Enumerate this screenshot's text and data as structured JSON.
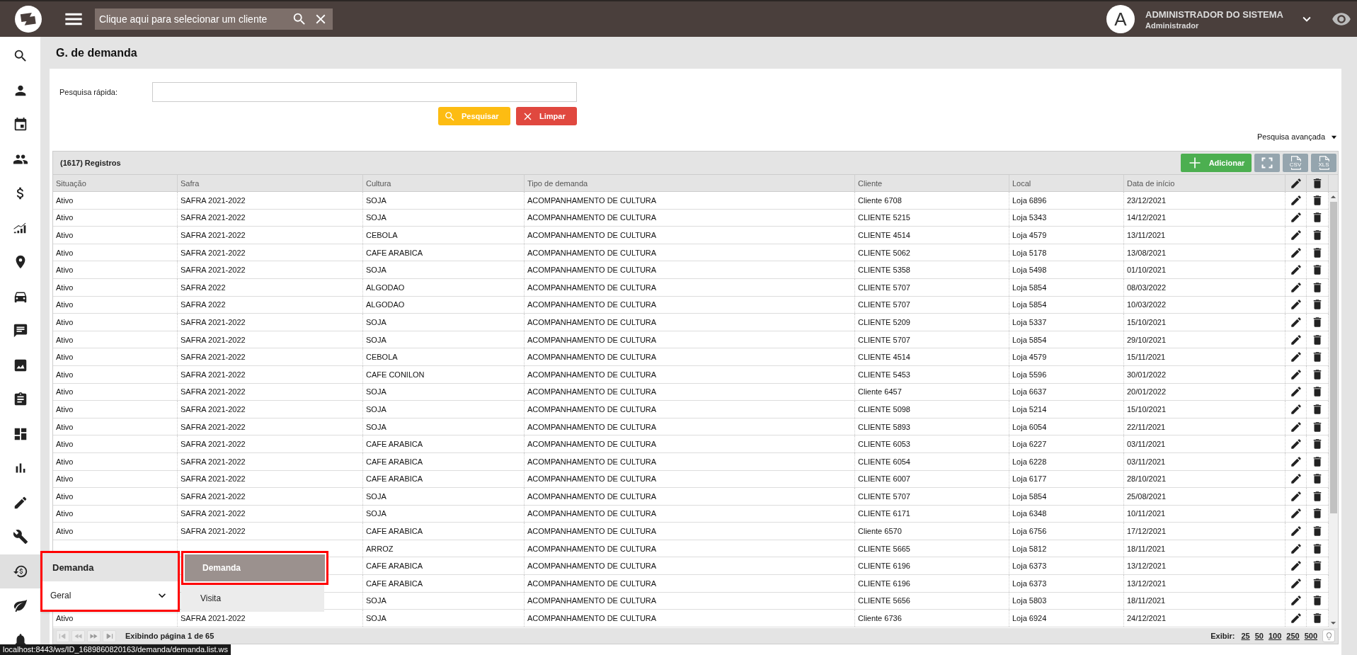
{
  "app_bar": {
    "client_search": {
      "placeholder": "Clique aqui para selecionar um cliente"
    },
    "user": {
      "avatar_letter": "A",
      "name": "ADMINISTRADOR DO SISTEMA",
      "role": "Administrador"
    }
  },
  "sidebar": {
    "items": [
      {
        "kind": "search",
        "selected": false
      },
      {
        "kind": "person",
        "selected": false
      },
      {
        "kind": "calendar",
        "selected": false
      },
      {
        "kind": "people",
        "selected": false
      },
      {
        "kind": "dollar",
        "selected": false
      },
      {
        "kind": "signal",
        "selected": false
      },
      {
        "kind": "pin",
        "selected": false
      },
      {
        "kind": "car",
        "selected": false
      },
      {
        "kind": "chat",
        "selected": false
      },
      {
        "kind": "image",
        "selected": false
      },
      {
        "kind": "clipboard",
        "selected": false
      },
      {
        "kind": "dashboard",
        "selected": false
      },
      {
        "kind": "bars",
        "selected": false
      },
      {
        "kind": "pencil",
        "selected": false
      },
      {
        "kind": "wrench",
        "selected": false
      },
      {
        "kind": "history",
        "selected": true
      },
      {
        "kind": "leaf",
        "selected": false
      },
      {
        "kind": "bell",
        "selected": false
      }
    ]
  },
  "page_title": "G. de demanda",
  "quick_search": {
    "label": "Pesquisa rápida:",
    "buttons": [
      {
        "kind": "search",
        "label": "Pesquisar"
      },
      {
        "kind": "clear",
        "label": "Limpar"
      }
    ]
  },
  "advanced_search": {
    "label": "Pesquisa avançada",
    "expanded": false
  },
  "grid": {
    "count": "(1617) Registros",
    "toolbar": [
      {
        "kind": "add",
        "label": "Adicionar"
      },
      {
        "kind": "fullscreen"
      },
      {
        "kind": "file",
        "label": "CSV"
      },
      {
        "kind": "file",
        "label": "XLS"
      }
    ],
    "columns": [
      "Situação",
      "Safra",
      "Cultura",
      "Tipo de demanda",
      "Cliente",
      "Local",
      "Data de início"
    ],
    "rows": [
      {
        "situacao": "Ativo",
        "safra": "SAFRA 2021-2022",
        "cultura": "SOJA",
        "tipo": "ACOMPANHAMENTO DE CULTURA",
        "cliente": "Cliente 6708",
        "local": "Loja 6896",
        "data": "23/12/2021"
      },
      {
        "situacao": "Ativo",
        "safra": "SAFRA 2021-2022",
        "cultura": "SOJA",
        "tipo": "ACOMPANHAMENTO DE CULTURA",
        "cliente": "CLIENTE 5215",
        "local": "Loja 5343",
        "data": "14/12/2021"
      },
      {
        "situacao": "Ativo",
        "safra": "SAFRA 2021-2022",
        "cultura": "CEBOLA",
        "tipo": "ACOMPANHAMENTO DE CULTURA",
        "cliente": "CLIENTE 4514",
        "local": "Loja 4579",
        "data": "13/11/2021"
      },
      {
        "situacao": "Ativo",
        "safra": "SAFRA 2021-2022",
        "cultura": "CAFE ARABICA",
        "tipo": "ACOMPANHAMENTO DE CULTURA",
        "cliente": "CLIENTE 5062",
        "local": "Loja 5178",
        "data": "13/08/2021"
      },
      {
        "situacao": "Ativo",
        "safra": "SAFRA 2021-2022",
        "cultura": "SOJA",
        "tipo": "ACOMPANHAMENTO DE CULTURA",
        "cliente": "CLIENTE 5358",
        "local": "Loja 5498",
        "data": "01/10/2021"
      },
      {
        "situacao": "Ativo",
        "safra": "SAFRA 2022",
        "cultura": "ALGODAO",
        "tipo": "ACOMPANHAMENTO DE CULTURA",
        "cliente": "CLIENTE 5707",
        "local": "Loja 5854",
        "data": "08/03/2022"
      },
      {
        "situacao": "Ativo",
        "safra": "SAFRA 2022",
        "cultura": "ALGODAO",
        "tipo": "ACOMPANHAMENTO DE CULTURA",
        "cliente": "CLIENTE 5707",
        "local": "Loja 5854",
        "data": "10/03/2022"
      },
      {
        "situacao": "Ativo",
        "safra": "SAFRA 2021-2022",
        "cultura": "SOJA",
        "tipo": "ACOMPANHAMENTO DE CULTURA",
        "cliente": "CLIENTE 5209",
        "local": "Loja 5337",
        "data": "15/10/2021"
      },
      {
        "situacao": "Ativo",
        "safra": "SAFRA 2021-2022",
        "cultura": "SOJA",
        "tipo": "ACOMPANHAMENTO DE CULTURA",
        "cliente": "CLIENTE 5707",
        "local": "Loja 5854",
        "data": "29/10/2021"
      },
      {
        "situacao": "Ativo",
        "safra": "SAFRA 2021-2022",
        "cultura": "CEBOLA",
        "tipo": "ACOMPANHAMENTO DE CULTURA",
        "cliente": "CLIENTE 4514",
        "local": "Loja 4579",
        "data": "15/11/2021"
      },
      {
        "situacao": "Ativo",
        "safra": "SAFRA 2021-2022",
        "cultura": "CAFE CONILON",
        "tipo": "ACOMPANHAMENTO DE CULTURA",
        "cliente": "CLIENTE 5453",
        "local": "Loja 5596",
        "data": "30/01/2022"
      },
      {
        "situacao": "Ativo",
        "safra": "SAFRA 2021-2022",
        "cultura": "SOJA",
        "tipo": "ACOMPANHAMENTO DE CULTURA",
        "cliente": "Cliente 6457",
        "local": "Loja 6637",
        "data": "20/01/2022"
      },
      {
        "situacao": "Ativo",
        "safra": "SAFRA 2021-2022",
        "cultura": "SOJA",
        "tipo": "ACOMPANHAMENTO DE CULTURA",
        "cliente": "CLIENTE 5098",
        "local": "Loja 5214",
        "data": "15/10/2021"
      },
      {
        "situacao": "Ativo",
        "safra": "SAFRA 2021-2022",
        "cultura": "SOJA",
        "tipo": "ACOMPANHAMENTO DE CULTURA",
        "cliente": "CLIENTE 5893",
        "local": "Loja 6054",
        "data": "22/11/2021"
      },
      {
        "situacao": "Ativo",
        "safra": "SAFRA 2021-2022",
        "cultura": "CAFE ARABICA",
        "tipo": "ACOMPANHAMENTO DE CULTURA",
        "cliente": "CLIENTE 6053",
        "local": "Loja 6227",
        "data": "03/11/2021"
      },
      {
        "situacao": "Ativo",
        "safra": "SAFRA 2021-2022",
        "cultura": "CAFE ARABICA",
        "tipo": "ACOMPANHAMENTO DE CULTURA",
        "cliente": "CLIENTE 6054",
        "local": "Loja 6228",
        "data": "03/11/2021"
      },
      {
        "situacao": "Ativo",
        "safra": "SAFRA 2021-2022",
        "cultura": "CAFE ARABICA",
        "tipo": "ACOMPANHAMENTO DE CULTURA",
        "cliente": "CLIENTE 6007",
        "local": "Loja 6177",
        "data": "28/10/2021"
      },
      {
        "situacao": "Ativo",
        "safra": "SAFRA 2021-2022",
        "cultura": "SOJA",
        "tipo": "ACOMPANHAMENTO DE CULTURA",
        "cliente": "CLIENTE 5707",
        "local": "Loja 5854",
        "data": "25/08/2021"
      },
      {
        "situacao": "Ativo",
        "safra": "SAFRA 2021-2022",
        "cultura": "SOJA",
        "tipo": "ACOMPANHAMENTO DE CULTURA",
        "cliente": "CLIENTE 6171",
        "local": "Loja 6348",
        "data": "10/11/2021"
      },
      {
        "situacao": "Ativo",
        "safra": "SAFRA 2021-2022",
        "cultura": "CAFE ARABICA",
        "tipo": "ACOMPANHAMENTO DE CULTURA",
        "cliente": "Cliente 6570",
        "local": "Loja 6756",
        "data": "17/12/2021"
      },
      {
        "cultura": "ARROZ",
        "tipo": "ACOMPANHAMENTO DE CULTURA",
        "cliente": "CLIENTE 5665",
        "local": "Loja 5812",
        "data": "18/11/2021"
      },
      {
        "cultura": "CAFE ARABICA",
        "tipo": "ACOMPANHAMENTO DE CULTURA",
        "cliente": "CLIENTE 6196",
        "local": "Loja 6373",
        "data": "13/12/2021"
      },
      {
        "cultura": "CAFE ARABICA",
        "tipo": "ACOMPANHAMENTO DE CULTURA",
        "cliente": "CLIENTE 6196",
        "local": "Loja 6373",
        "data": "13/12/2021"
      },
      {
        "cultura": "SOJA",
        "tipo": "ACOMPANHAMENTO DE CULTURA",
        "cliente": "CLIENTE 5656",
        "local": "Loja 5803",
        "data": "18/11/2021"
      },
      {
        "situacao": "Ativo",
        "safra": "SAFRA 2021-2022",
        "cultura": "SOJA",
        "tipo": "ACOMPANHAMENTO DE CULTURA",
        "cliente": "Cliente 6736",
        "local": "Loja 6924",
        "data": "24/12/2021"
      }
    ],
    "pager": {
      "status": "Exibindo página 1 de 65",
      "page_size_label": "Exibir:",
      "page_sizes": [
        "25",
        "50",
        "100",
        "250",
        "500"
      ]
    }
  },
  "flyout": {
    "title": "Demanda",
    "group": "Geral",
    "items": [
      {
        "label": "Demanda",
        "selected": true
      },
      {
        "label": "Visita",
        "selected": false
      }
    ]
  },
  "status_url": "localhost:8443/ws/ID_1689860820163/demanda/demanda.list.ws"
}
